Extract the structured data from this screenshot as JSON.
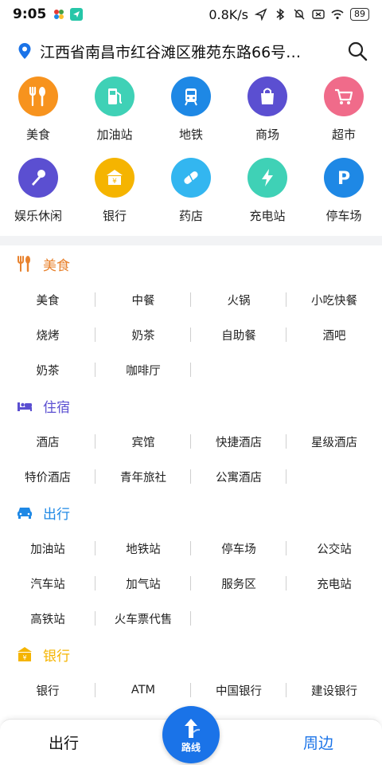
{
  "statusbar": {
    "time": "9:05",
    "speed": "0.8K/s",
    "battery": "89"
  },
  "location": {
    "address": "江西省南昌市红谷滩区雅苑东路66号…"
  },
  "categories": [
    {
      "label": "美食",
      "icon": "fork-spoon-icon",
      "color": "#f7931e"
    },
    {
      "label": "加油站",
      "icon": "gas-pump-icon",
      "color": "#3fd1b6"
    },
    {
      "label": "地铁",
      "icon": "metro-train-icon",
      "color": "#1e88e5"
    },
    {
      "label": "商场",
      "icon": "shopping-bag-icon",
      "color": "#5b4fd1"
    },
    {
      "label": "超市",
      "icon": "shopping-cart-icon",
      "color": "#f06b8a"
    },
    {
      "label": "娱乐休闲",
      "icon": "microphone-icon",
      "color": "#5b4fd1"
    },
    {
      "label": "银行",
      "icon": "bank-icon",
      "color": "#f5b400"
    },
    {
      "label": "药店",
      "icon": "pill-icon",
      "color": "#33b6f0"
    },
    {
      "label": "充电站",
      "icon": "lightning-icon",
      "color": "#3fd1b6"
    },
    {
      "label": "停车场",
      "icon": "parking-icon",
      "color": "#1e88e5"
    }
  ],
  "sections": [
    {
      "title": "美食",
      "color": "#e8822e",
      "icon": "fork-spoon-icon",
      "items": [
        "美食",
        "中餐",
        "火锅",
        "小吃快餐",
        "烧烤",
        "奶茶",
        "自助餐",
        "酒吧",
        "奶茶",
        "咖啡厅"
      ]
    },
    {
      "title": "住宿",
      "color": "#5b4fd1",
      "icon": "bed-icon",
      "items": [
        "酒店",
        "宾馆",
        "快捷酒店",
        "星级酒店",
        "特价酒店",
        "青年旅社",
        "公寓酒店"
      ]
    },
    {
      "title": "出行",
      "color": "#1e88e5",
      "icon": "car-icon",
      "items": [
        "加油站",
        "地铁站",
        "停车场",
        "公交站",
        "汽车站",
        "加气站",
        "服务区",
        "充电站",
        "高铁站",
        "火车票代售"
      ]
    },
    {
      "title": "银行",
      "color": "#f5b400",
      "icon": "bank-icon",
      "items": [
        "银行",
        "ATM",
        "中国银行",
        "建设银行"
      ]
    }
  ],
  "bottomnav": {
    "left": "出行",
    "center": "路线",
    "right": "周边"
  },
  "colors": {
    "accent": "#1a73e8"
  }
}
